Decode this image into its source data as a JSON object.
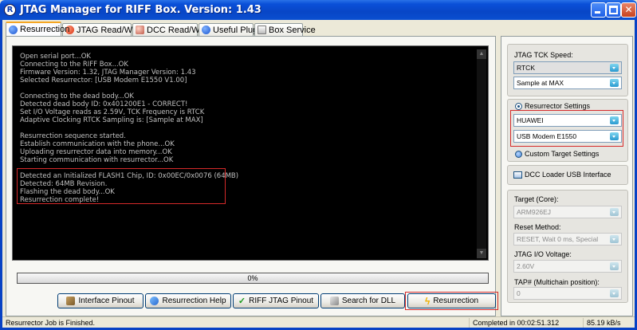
{
  "window": {
    "title": "JTAG Manager for RIFF Box. Version: 1.43",
    "icon_letter": "R",
    "minimize_icon": "minimize-icon",
    "maximize_icon": "maximize-icon",
    "close_glyph": "✕"
  },
  "tabs": [
    {
      "label": "Resurrection",
      "icon": "info-icon",
      "active": true
    },
    {
      "label": "JTAG Read/Write",
      "icon": "chip-icon",
      "active": false
    },
    {
      "label": "DCC Read/Write",
      "icon": "gear-icon",
      "active": false
    },
    {
      "label": "Useful Plugins",
      "icon": "info-icon",
      "active": false
    },
    {
      "label": "Box Service",
      "icon": "box-icon",
      "active": false
    }
  ],
  "console": {
    "lines": [
      "Open serial port...OK",
      "Connecting to the RIFF Box...OK",
      "Firmware Version: 1.32, JTAG Manager Version: 1.43",
      "Selected Resurrector: [USB Modem E1550 V1.00]",
      "",
      "Connecting to the dead body...OK",
      "Detected dead body ID: 0x401200E1 - CORRECT!",
      "Set I/O Voltage reads as 2.59V, TCK Frequency is RTCK",
      "Adaptive Clocking RTCK Sampling is: [Sample at MAX]",
      "",
      "Resurrection sequence started.",
      "Establish communication with the phone...OK",
      "Uploading resurrector data into memory...OK",
      "Starting communication with resurrector...OK",
      "",
      "Detected an Initialized FLASH1 Chip, ID: 0x00EC/0x0076 (64MB)",
      "Detected: 64MB Revision.",
      "Flashing the dead body...OK",
      "Resurrection complete!"
    ]
  },
  "progress": {
    "label": "0%",
    "value": 0
  },
  "buttons": {
    "interface_pinout": "Interface Pinout",
    "resurrection_help": "Resurrection Help",
    "riff_jtag_pinout": "RIFF JTAG Pinout",
    "search_for_dll": "Search for DLL",
    "resurrection": "Resurrection",
    "check_glyph": "✓",
    "bolt_glyph": "ϟ"
  },
  "side": {
    "tck_speed_label": "JTAG TCK Speed:",
    "tck_speed_value": "RTCK",
    "sampling_value": "Sample at MAX",
    "resurrector_settings_label": "Resurrector Settings",
    "manufacturer_value": "HUAWEI",
    "model_value": "USB Modem E1550",
    "custom_target_label": "Custom Target Settings",
    "dcc_loader_label": "DCC Loader USB Interface",
    "target_core_label": "Target (Core):",
    "target_core_value": "ARM926EJ",
    "reset_method_label": "Reset Method:",
    "reset_method_value": "RESET, Wait 0 ms, Special",
    "io_voltage_label": "JTAG I/O Voltage:",
    "io_voltage_value": "2.60V",
    "tap_label": "TAP# (Multichain position):",
    "tap_value": "0"
  },
  "status": {
    "message": "Resurrector Job is Finished.",
    "completed": "Completed in 00:02:51.312",
    "speed": "85.19 kB/s"
  }
}
